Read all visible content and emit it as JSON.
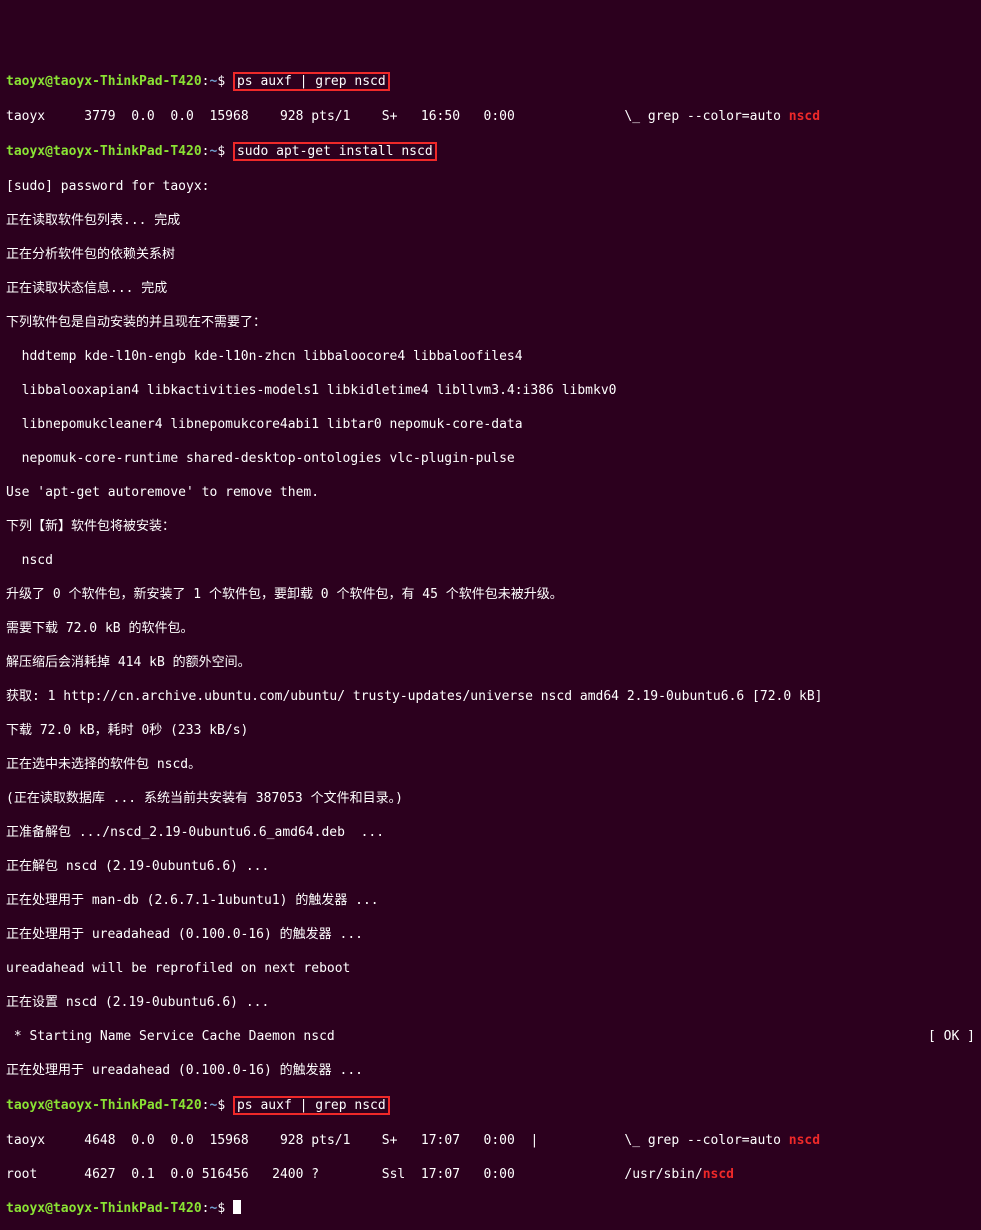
{
  "prompt": {
    "user": "taoyx@taoyx-ThinkPad-T420",
    "sep": ":",
    "path": "~",
    "dollar": "$ "
  },
  "cmd1": "ps auxf | grep nscd",
  "ps1": {
    "user": "taoyx",
    "pid": "3779",
    "cpu": "0.0",
    "mem": "0.0",
    "vsz": "15968",
    "rss": "928",
    "tty": "pts/1",
    "stat": "S+",
    "start": "16:50",
    "time": "0:00",
    "tree": "\\_ grep --color=auto ",
    "match": "nscd"
  },
  "cmd2": "sudo apt-get install nscd",
  "sudo_prompt": "[sudo] password for taoyx:",
  "l1": "正在读取软件包列表... 完成",
  "l2": "正在分析软件包的依赖关系树",
  "l3": "正在读取状态信息... 完成",
  "l4": "下列软件包是自动安装的并且现在不需要了：",
  "auto1": "  hddtemp kde-l10n-engb kde-l10n-zhcn libbaloocore4 libbaloofiles4",
  "auto2": "  libbalooxapian4 libkactivities-models1 libkidletime4 libllvm3.4:i386 libmkv0",
  "auto3": "  libnepomukcleaner4 libnepomukcore4abi1 libtar0 nepomuk-core-data",
  "auto4": "  nepomuk-core-runtime shared-desktop-ontologies vlc-plugin-pulse",
  "use_autoremove": "Use 'apt-get autoremove' to remove them.",
  "l5": "下列【新】软件包将被安装：",
  "pkg": "  nscd",
  "l6": "升级了 0 个软件包，新安装了 1 个软件包，要卸载 0 个软件包，有 45 个软件包未被升级。",
  "l7": "需要下载 72.0 kB 的软件包。",
  "l8": "解压缩后会消耗掉 414 kB 的额外空间。",
  "l9": "获取: 1 http://cn.archive.ubuntu.com/ubuntu/ trusty-updates/universe nscd amd64 2.19-0ubuntu6.6 [72.0 kB]",
  "l10": "下载 72.0 kB，耗时 0秒 (233 kB/s)",
  "l11": "正在选中未选择的软件包 nscd。",
  "l12": "(正在读取数据库 ... 系统当前共安装有 387053 个文件和目录。)",
  "l13": "正准备解包 .../nscd_2.19-0ubuntu6.6_amd64.deb  ...",
  "l14": "正在解包 nscd (2.19-0ubuntu6.6) ...",
  "l15": "正在处理用于 man-db (2.6.7.1-1ubuntu1) 的触发器 ...",
  "l16": "正在处理用于 ureadahead (0.100.0-16) 的触发器 ...",
  "l17": "ureadahead will be reprofiled on next reboot",
  "l18": "正在设置 nscd (2.19-0ubuntu6.6) ...",
  "l19_left": " * Starting Name Service Cache Daemon nscd",
  "l19_right": "[ OK ]",
  "l20": "正在处理用于 ureadahead (0.100.0-16) 的触发器 ...",
  "cmd3": "ps auxf | grep nscd",
  "ps2a": {
    "user": "taoyx",
    "pid": "4648",
    "cpu": "0.0",
    "mem": "0.0",
    "vsz": "15968",
    "rss": "928",
    "tty": "pts/1",
    "stat": "S+",
    "start": "17:07",
    "time": "0:00",
    "tree": "|           \\_ grep --color=auto ",
    "match": "nscd"
  },
  "ps2b": {
    "user": "root",
    "pid": "4627",
    "cpu": "0.1",
    "mem": "0.0",
    "vsz": "516456",
    "rss": "2400",
    "tty": "?",
    "stat": "Ssl",
    "start": "17:07",
    "time": "0:00",
    "cmd_pre": "/usr/sbin/",
    "cmd_hl": "nscd"
  }
}
